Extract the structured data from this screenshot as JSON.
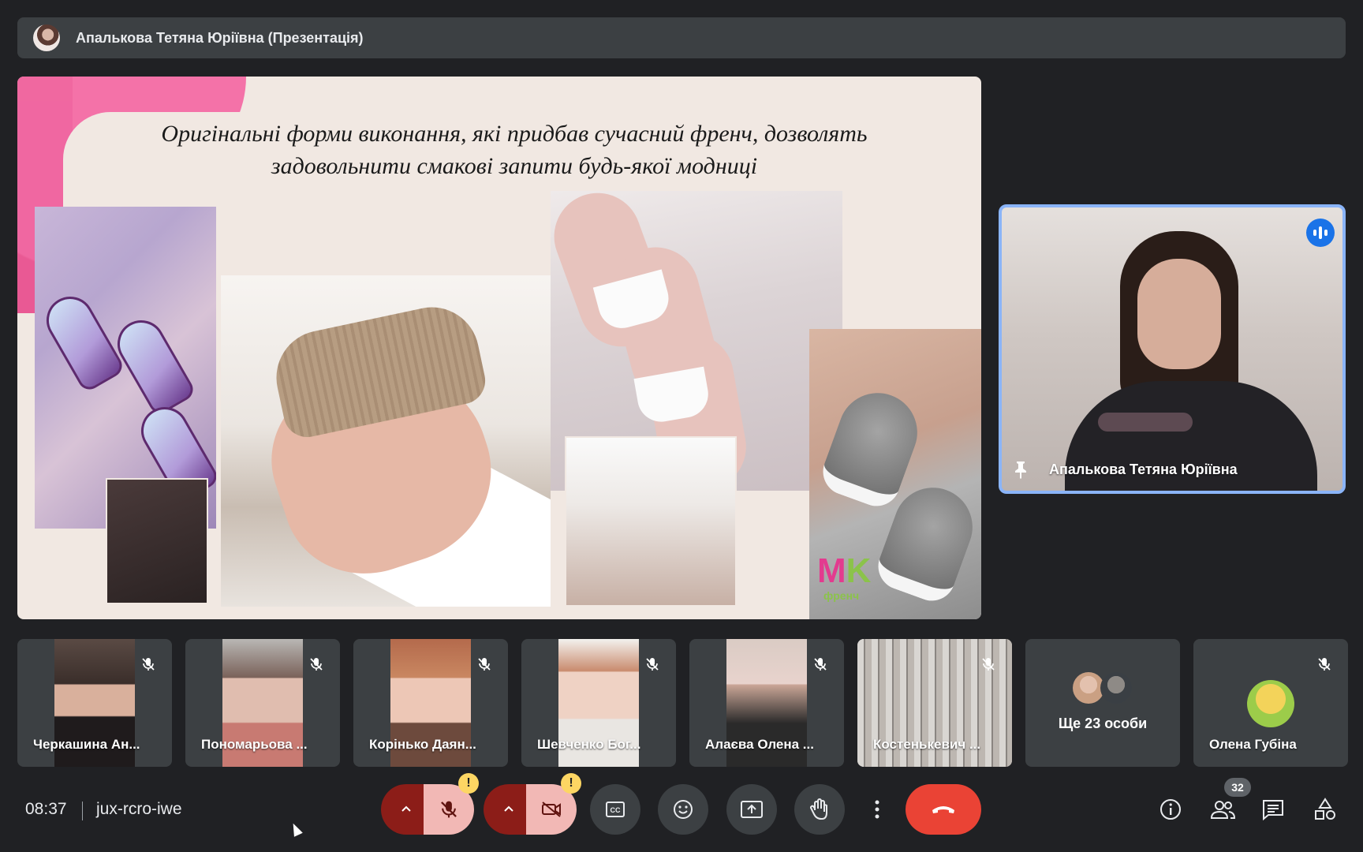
{
  "presentation": {
    "title": "Апалькова Тетяна Юріївна (Презентація)",
    "slide_heading_line1": "Оригінальні форми виконання, які придбав сучасний френч, дозволять",
    "slide_heading_line2": "задовольнити смакові запити будь-якої модниці",
    "slide_logo_letters_m": "M",
    "slide_logo_letters_k": "K",
    "slide_logo_sub": "френч"
  },
  "speaker": {
    "name": "Апалькова Тетяна Юріївна"
  },
  "participants": [
    {
      "name": "Черкашина Ан...",
      "muted": true
    },
    {
      "name": "Пономарьова ...",
      "muted": true
    },
    {
      "name": "Корінько Даян...",
      "muted": true
    },
    {
      "name": "Шевченко Бог...",
      "muted": true
    },
    {
      "name": "Алаєва Олена ...",
      "muted": true
    },
    {
      "name": "Костенькевич ...",
      "muted": true
    },
    {
      "name": "Ще 23 особи",
      "muted": false
    },
    {
      "name": "Олена Губіна",
      "muted": true
    }
  ],
  "meeting": {
    "time": "08:37",
    "code": "jux-rcro-iwe",
    "participant_count": "32"
  },
  "icons": {
    "mic_warning": "!",
    "cam_warning": "!"
  },
  "colors": {
    "background": "#202124",
    "surface": "#3c4043",
    "active_speaker_border": "#8ab4f8",
    "end_call": "#ea4335",
    "muted_control": "#f2b8b5",
    "warning": "#fdd663"
  }
}
